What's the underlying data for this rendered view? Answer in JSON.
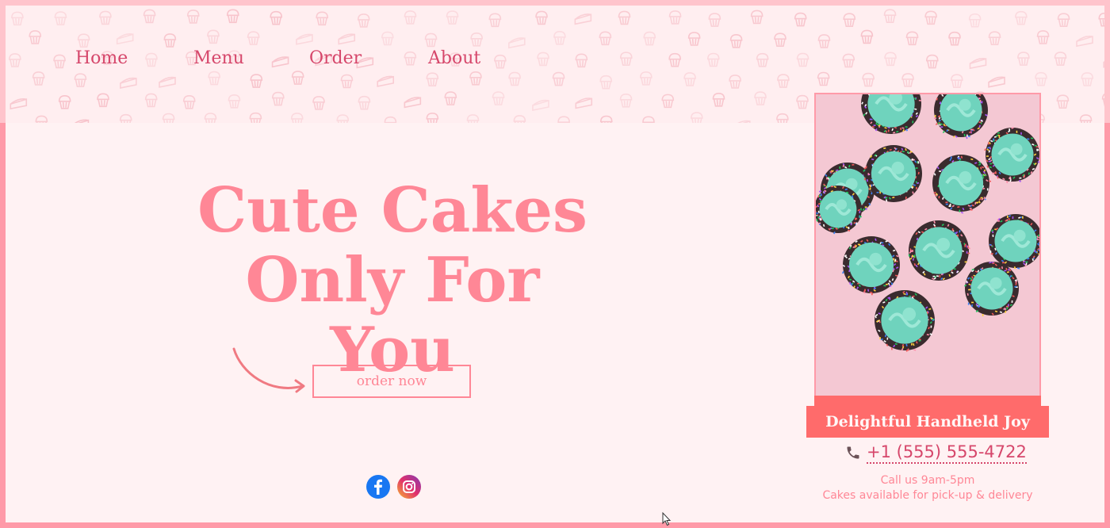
{
  "nav": {
    "items": [
      {
        "label": "Home"
      },
      {
        "label": "Menu"
      },
      {
        "label": "Order"
      },
      {
        "label": "About"
      }
    ]
  },
  "hero": {
    "title_line1": "Cute Cakes",
    "title_line2": "Only For You",
    "order_button": "order now"
  },
  "social": {
    "icons": [
      "facebook-icon",
      "instagram-icon"
    ]
  },
  "card": {
    "image_alt": "Teal frosted cupcakes with sprinkles",
    "banner": "Delightful Handheld Joy",
    "phone": "+1 (555) 555-4722",
    "hours": "Call us 9am-5pm",
    "availability": "Cakes available for pick-up & delivery"
  },
  "colors": {
    "accent": "#ff8796",
    "nav_text": "#d6476b",
    "banner": "#ff6b6b",
    "background": "#fff2f3"
  }
}
